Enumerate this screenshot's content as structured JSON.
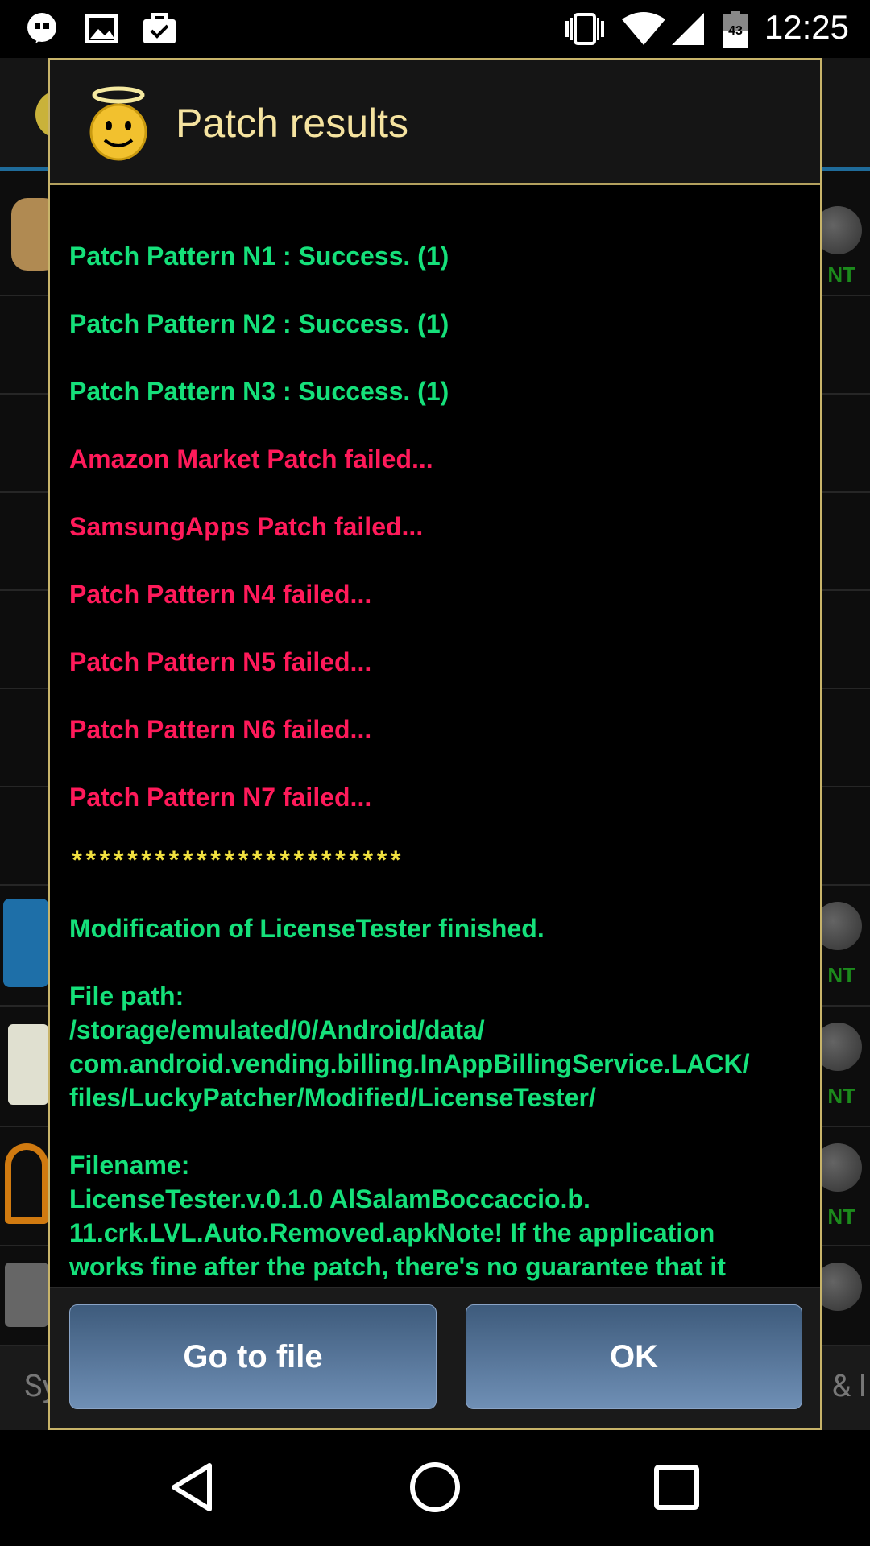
{
  "status_bar": {
    "time": "12:25",
    "battery_level": "43",
    "left_icons": [
      "hangouts-icon",
      "image-icon",
      "briefcase-check-icon"
    ],
    "right_icons": [
      "vibrate-icon",
      "wifi-icon",
      "signal-icon",
      "battery-icon"
    ]
  },
  "dialog": {
    "title": "Patch results",
    "lines": [
      {
        "text": "Patch Pattern N1 : Success. (1)",
        "status": "success"
      },
      {
        "text": "Patch Pattern N2 : Success. (1)",
        "status": "success"
      },
      {
        "text": "Patch Pattern N3 : Success. (1)",
        "status": "success"
      },
      {
        "text": "Amazon Market Patch failed...",
        "status": "fail"
      },
      {
        "text": "SamsungApps Patch failed...",
        "status": "fail"
      },
      {
        "text": "Patch Pattern N4 failed...",
        "status": "fail"
      },
      {
        "text": "Patch Pattern N5 failed...",
        "status": "fail"
      },
      {
        "text": "Patch Pattern N6 failed...",
        "status": "fail"
      },
      {
        "text": "Patch Pattern N7 failed...",
        "status": "fail"
      }
    ],
    "stars": "************************",
    "finished": "Modification of LicenseTester finished.",
    "file_path_label": "File path:",
    "file_path_1": "/storage/emulated/0/Android/data/",
    "file_path_2": "com.android.vending.billing.InAppBillingService.LACK/",
    "file_path_3": "files/LuckyPatcher/Modified/LicenseTester/",
    "filename_label": "Filename:",
    "filename_1": "LicenseTester.v.0.1.0 AlSalamBoccaccio.b.",
    "filename_2": "11.crk.LVL.Auto.Removed.apkNote! If the application",
    "filename_3": "works fine after the patch, there's no guarantee that it",
    "buttons": {
      "go_to_file": "Go to file",
      "ok": "OK"
    }
  },
  "background": {
    "bottom_left_text": "Sy",
    "bottom_right_text": "& I",
    "badge_text": "NT"
  },
  "colors": {
    "success": "#15e07a",
    "fail": "#ff1a5a",
    "stars": "#f0e040",
    "title": "#f5e3a0",
    "button": "#5678a0"
  }
}
